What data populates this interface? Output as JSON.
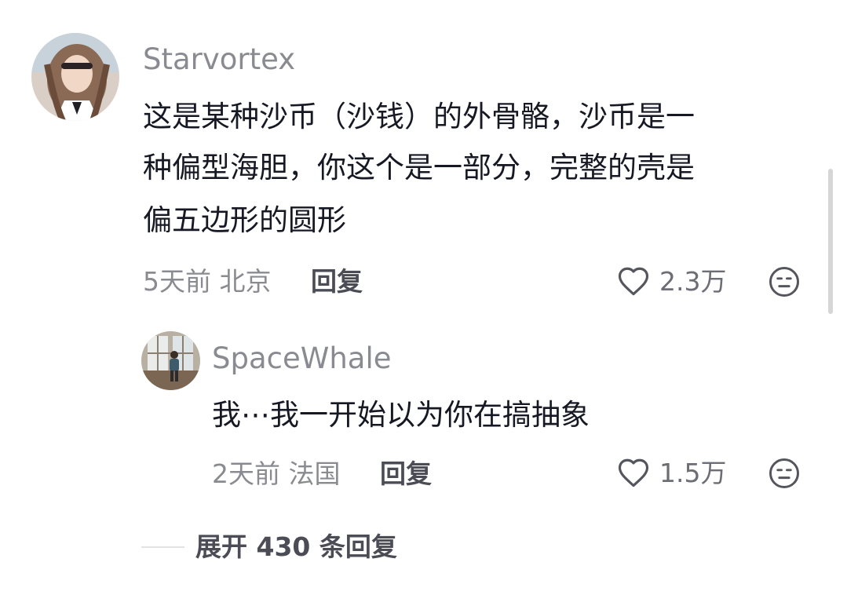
{
  "comment": {
    "username": "Starvortex",
    "lines": [
      "这是某种沙币（沙钱）的外骨骼，沙币是一",
      "种偏型海胆，你这个是一部分，完整的壳是",
      "偏五边形的圆形"
    ],
    "time_location": "5天前 北京",
    "reply_label": "回复",
    "like_count": "2.3万"
  },
  "reply": {
    "username": "SpaceWhale",
    "text": "我⋯我一开始以为你在搞抽象",
    "time_location": "2天前 法国",
    "reply_label": "回复",
    "like_count": "1.5万"
  },
  "expand": {
    "label": "展开 430 条回复"
  },
  "icons": {
    "like": "heart-outline-icon",
    "dislike": "meh-face-icon"
  },
  "colors": {
    "username": "#8a8b91",
    "text": "#161823",
    "reply": "#4b4c55"
  }
}
